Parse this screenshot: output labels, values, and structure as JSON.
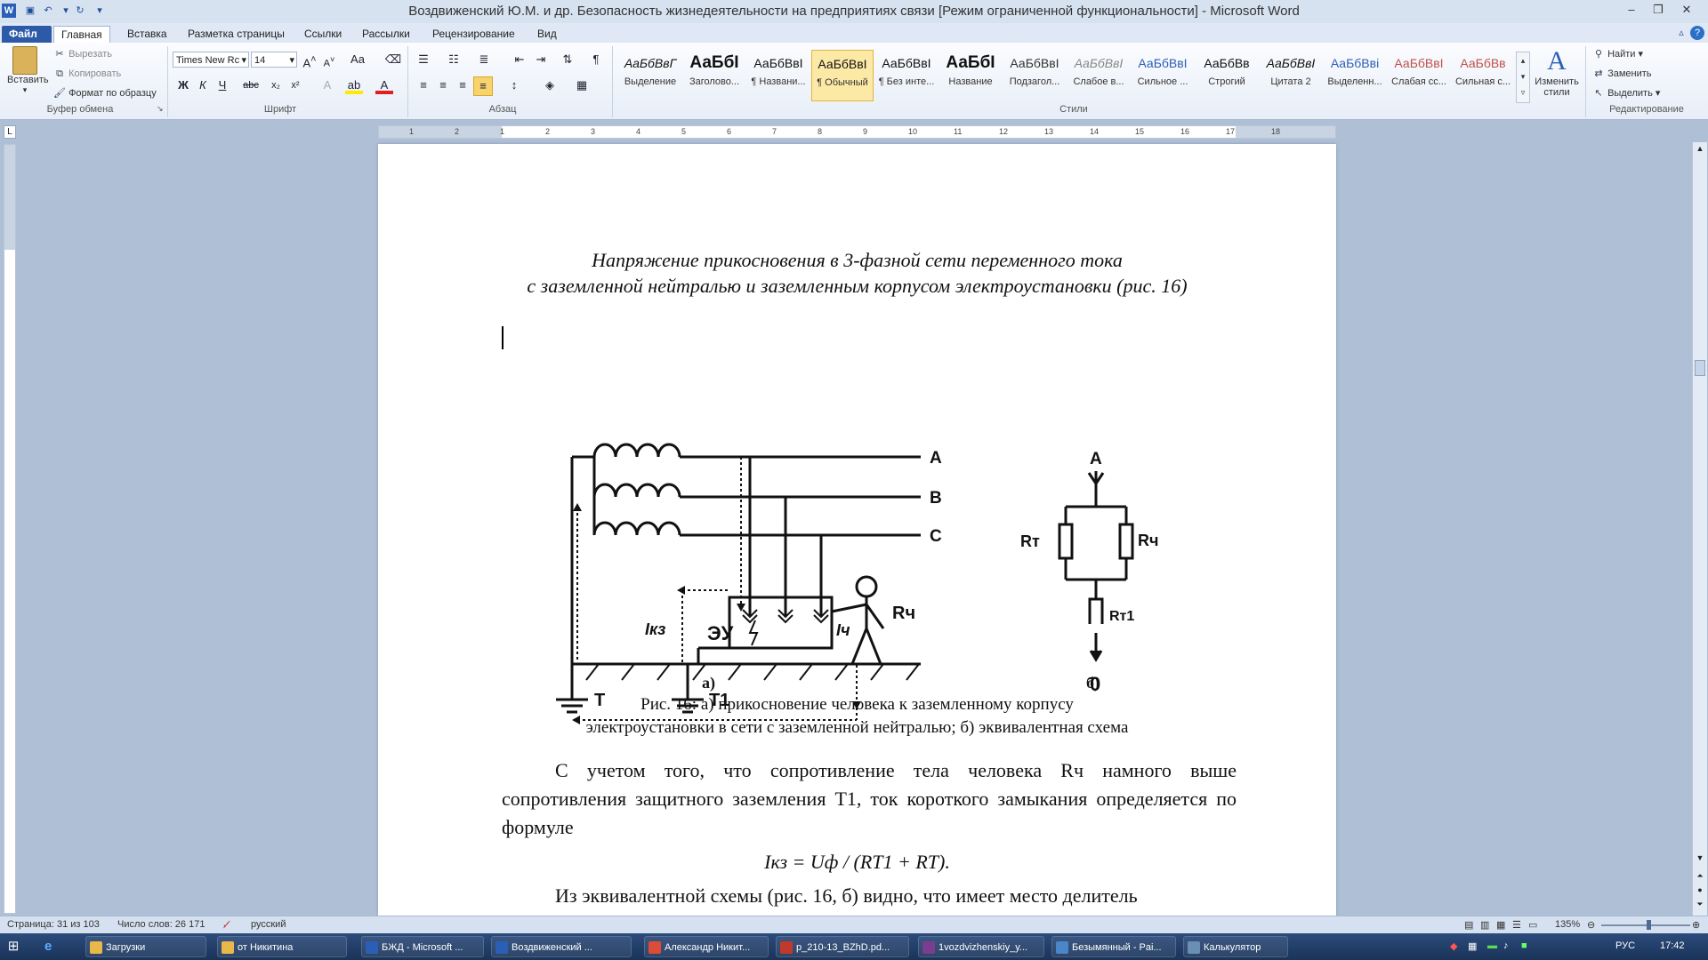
{
  "window": {
    "title": "Воздвиженский Ю.М. и др. Безопасность жизнедеятельности на предприятиях связи [Режим ограниченной функциональности]  -  Microsoft Word",
    "min": "–",
    "max": "❐",
    "close": "✕"
  },
  "tabs": [
    "Файл",
    "Главная",
    "Вставка",
    "Разметка страницы",
    "Ссылки",
    "Рассылки",
    "Рецензирование",
    "Вид"
  ],
  "ribbon": {
    "clipboard": {
      "paste": "Вставить",
      "cut": "Вырезать",
      "copy": "Копировать",
      "format_painter": "Формат по образцу",
      "label": "Буфер обмена"
    },
    "font": {
      "name": "Times New Rc",
      "size": "14",
      "label": "Шрифт"
    },
    "paragraph": {
      "label": "Абзац"
    },
    "styles": {
      "label": "Стили",
      "items": [
        {
          "sample": "АаБбВвГ",
          "name": "Выделение"
        },
        {
          "sample": "АаБбІ",
          "name": "Заголово..."
        },
        {
          "sample": "АаБбВвІ",
          "name": "¶ Названи..."
        },
        {
          "sample": "АаБбВвІ",
          "name": "¶ Обычный"
        },
        {
          "sample": "АаБбВвІ",
          "name": "¶ Без инте..."
        },
        {
          "sample": "АаБбІ",
          "name": "Название"
        },
        {
          "sample": "АаБбВвІ",
          "name": "Подзагол..."
        },
        {
          "sample": "АаБбВвІ",
          "name": "Слабое в..."
        },
        {
          "sample": "АаБбВвІ",
          "name": "Сильное ..."
        },
        {
          "sample": "АаБбВв",
          "name": "Строгий"
        },
        {
          "sample": "АаБбВвІ",
          "name": "Цитата 2"
        },
        {
          "sample": "АаБбВві",
          "name": "Выделенн..."
        },
        {
          "sample": "АаБбВвІ",
          "name": "Слабая сс..."
        },
        {
          "sample": "АаБбВв",
          "name": "Сильная с..."
        }
      ],
      "change": "Изменить стили"
    },
    "editing": {
      "find": "Найти",
      "replace": "Заменить",
      "select": "Выделить",
      "label": "Редактирование"
    }
  },
  "ruler_numbers": [
    "1",
    "2",
    "1",
    "2",
    "3",
    "4",
    "5",
    "6",
    "7",
    "8",
    "9",
    "10",
    "11",
    "12",
    "13",
    "14",
    "15",
    "16",
    "17",
    "18"
  ],
  "doc": {
    "heading_line1": "Напряжение прикосновения в 3-фазной сети переменного тока",
    "heading_line2": "с заземленной нейтралью и заземленным корпусом электроустановки (рис. 16)",
    "fig_a_label": "а)",
    "fig_b_label": "б)",
    "caption_line1": "Рис. 16: а) прикосновение человека к заземленному корпусу",
    "caption_line2": "электроустановки в сети с заземленной нейтралью; б) эквивалентная схема",
    "para1": "С учетом того, что сопротивление тела человека Rч намного выше сопротивления защитного заземления T1, ток короткого замыкания определяется по формуле",
    "formula": "Iкз = Uф / (RT1 + RT).",
    "para2": "Из эквивалентной схемы (рис. 16, б) видно, что имеет место делитель"
  },
  "diagram": {
    "phase_a": "A",
    "phase_b": "B",
    "phase_c": "C",
    "ikz": "Iкз",
    "eu": "ЭУ",
    "ich": "Iч",
    "rch": "Rч",
    "t": "T",
    "t1": "T1"
  },
  "eq": {
    "a": "A",
    "rt": "Rт",
    "rch": "Rч",
    "rt1": "Rт1",
    "zero": "0"
  },
  "status": {
    "page": "Страница: 31 из 103",
    "words": "Число слов: 26 171",
    "lang": "русский",
    "zoom": "135%"
  },
  "taskbar": {
    "items": [
      {
        "label": "Загрузки",
        "color": "#e8b84a"
      },
      {
        "label": "от Никитина",
        "color": "#e8b84a"
      },
      {
        "label": "БЖД - Microsoft ...",
        "color": "#2b5fb5"
      },
      {
        "label": "Воздвиженский ...",
        "color": "#2b5fb5"
      },
      {
        "label": "Александр Никит...",
        "color": "#dd4b39"
      },
      {
        "label": "p_210-13_BZhD.pd...",
        "color": "#c0392b"
      },
      {
        "label": "1vozdvizhenskiy_y...",
        "color": "#7a3d8f"
      },
      {
        "label": "Безымянный - Pai...",
        "color": "#4a86c8"
      },
      {
        "label": "Калькулятор",
        "color": "#6a8fb5"
      }
    ],
    "lang": "РУС",
    "time": "17:42"
  }
}
